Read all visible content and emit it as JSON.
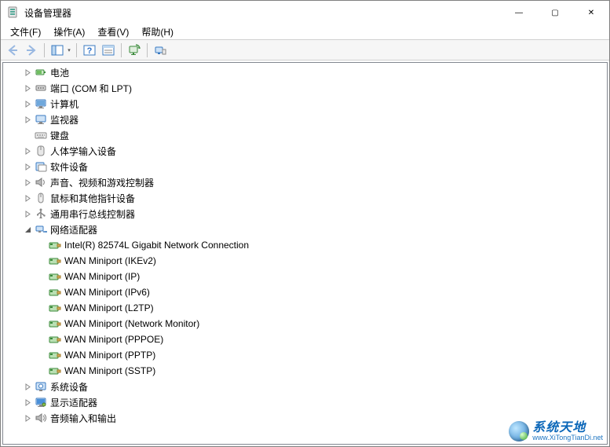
{
  "window": {
    "title": "设备管理器",
    "controls": {
      "minimize": "—",
      "maximize": "▢",
      "close": "✕"
    }
  },
  "menu": {
    "file": "文件(F)",
    "action": "操作(A)",
    "view": "查看(V)",
    "help": "帮助(H)"
  },
  "toolbar": {
    "back": "back-arrow",
    "forward": "forward-arrow",
    "show_hide": "show-hide-console-tree",
    "help": "help",
    "properties": "properties",
    "scan": "scan-for-hardware-changes",
    "devices": "devices-and-printers"
  },
  "tree": [
    {
      "label": "电池",
      "icon": "battery",
      "depth": 1,
      "expandable": true,
      "expanded": false
    },
    {
      "label": "端口 (COM 和 LPT)",
      "icon": "port",
      "depth": 1,
      "expandable": true,
      "expanded": false
    },
    {
      "label": "计算机",
      "icon": "computer",
      "depth": 1,
      "expandable": true,
      "expanded": false
    },
    {
      "label": "监视器",
      "icon": "monitor",
      "depth": 1,
      "expandable": true,
      "expanded": false
    },
    {
      "label": "键盘",
      "icon": "keyboard",
      "depth": 1,
      "expandable": false,
      "expanded": false
    },
    {
      "label": "人体学输入设备",
      "icon": "hid",
      "depth": 1,
      "expandable": true,
      "expanded": false
    },
    {
      "label": "软件设备",
      "icon": "software",
      "depth": 1,
      "expandable": true,
      "expanded": false
    },
    {
      "label": "声音、视频和游戏控制器",
      "icon": "sound",
      "depth": 1,
      "expandable": true,
      "expanded": false
    },
    {
      "label": "鼠标和其他指针设备",
      "icon": "mouse",
      "depth": 1,
      "expandable": true,
      "expanded": false
    },
    {
      "label": "通用串行总线控制器",
      "icon": "usb",
      "depth": 1,
      "expandable": true,
      "expanded": false
    },
    {
      "label": "网络适配器",
      "icon": "network",
      "depth": 1,
      "expandable": true,
      "expanded": true
    },
    {
      "label": "Intel(R) 82574L Gigabit Network Connection",
      "icon": "netcard",
      "depth": 2,
      "expandable": false,
      "expanded": false
    },
    {
      "label": "WAN Miniport (IKEv2)",
      "icon": "netcard",
      "depth": 2,
      "expandable": false,
      "expanded": false
    },
    {
      "label": "WAN Miniport (IP)",
      "icon": "netcard",
      "depth": 2,
      "expandable": false,
      "expanded": false
    },
    {
      "label": "WAN Miniport (IPv6)",
      "icon": "netcard",
      "depth": 2,
      "expandable": false,
      "expanded": false
    },
    {
      "label": "WAN Miniport (L2TP)",
      "icon": "netcard",
      "depth": 2,
      "expandable": false,
      "expanded": false
    },
    {
      "label": "WAN Miniport (Network Monitor)",
      "icon": "netcard",
      "depth": 2,
      "expandable": false,
      "expanded": false
    },
    {
      "label": "WAN Miniport (PPPOE)",
      "icon": "netcard",
      "depth": 2,
      "expandable": false,
      "expanded": false
    },
    {
      "label": "WAN Miniport (PPTP)",
      "icon": "netcard",
      "depth": 2,
      "expandable": false,
      "expanded": false
    },
    {
      "label": "WAN Miniport (SSTP)",
      "icon": "netcard",
      "depth": 2,
      "expandable": false,
      "expanded": false
    },
    {
      "label": "系统设备",
      "icon": "system",
      "depth": 1,
      "expandable": true,
      "expanded": false
    },
    {
      "label": "显示适配器",
      "icon": "display",
      "depth": 1,
      "expandable": true,
      "expanded": false
    },
    {
      "label": "音频输入和输出",
      "icon": "audio",
      "depth": 1,
      "expandable": true,
      "expanded": false
    }
  ],
  "watermark": {
    "cn": "系统天地",
    "en": "www.XiTongTianDi.net"
  }
}
